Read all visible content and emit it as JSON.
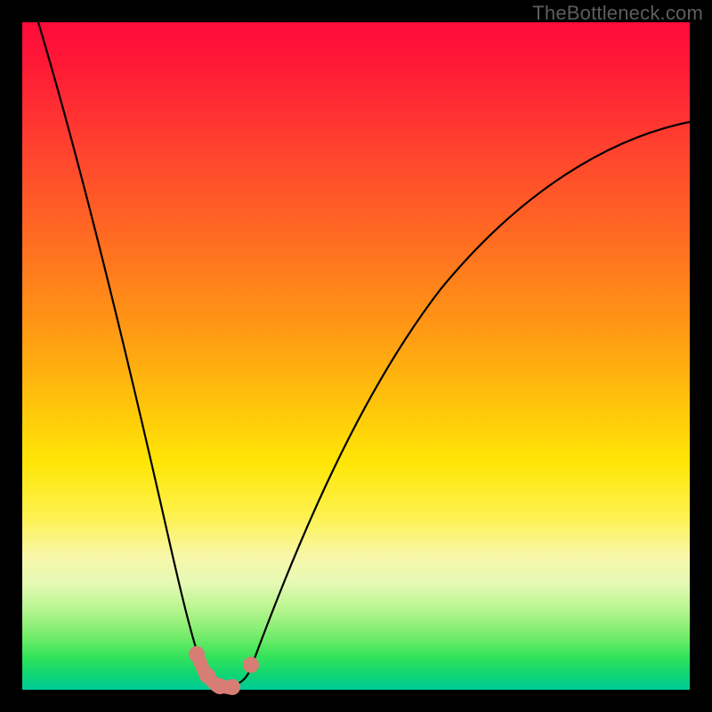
{
  "watermark": "TheBottleneck.com",
  "colors": {
    "background": "#000000",
    "curve": "#000000",
    "marker": "#d77d74",
    "gradient_top": "#ff0a3a",
    "gradient_bottom": "#00cc99"
  },
  "chart_data": {
    "type": "line",
    "title": "",
    "xlabel": "",
    "ylabel": "",
    "xlim": [
      0,
      100
    ],
    "ylim": [
      0,
      100
    ],
    "grid": false,
    "legend": false,
    "description": "Qualitative bottleneck curve: y approaches 0 (green / good) near an optimal x, rises sharply on both sides (red / bad). Background gradient encodes the y value (red high, green low). No axis ticks or numeric labels are shown.",
    "series": [
      {
        "name": "bottleneck-curve",
        "x": [
          0,
          5,
          10,
          15,
          20,
          23,
          26,
          28,
          29,
          30,
          31,
          33,
          36,
          40,
          46,
          54,
          62,
          72,
          84,
          100
        ],
        "y": [
          100,
          84,
          66,
          46,
          24,
          10,
          3,
          1,
          0,
          0,
          1,
          3,
          9,
          18,
          32,
          47,
          59,
          70,
          79,
          85
        ]
      }
    ],
    "highlight_points": [
      {
        "x": 25,
        "y": 5
      },
      {
        "x": 27,
        "y": 2
      },
      {
        "x": 29,
        "y": 0.5
      },
      {
        "x": 31,
        "y": 0.5
      },
      {
        "x": 33,
        "y": 3
      }
    ]
  }
}
